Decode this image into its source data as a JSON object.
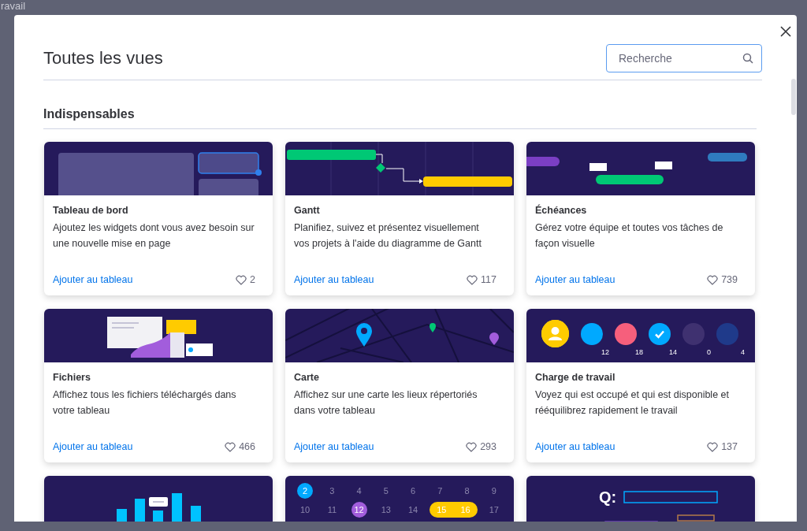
{
  "backdrop": {
    "title": "ravail"
  },
  "modal": {
    "title": "Toutes les vues",
    "search": {
      "placeholder": "Recherche"
    }
  },
  "section": {
    "title": "Indispensables"
  },
  "cards": [
    {
      "kind": "dashboard",
      "title": "Tableau de bord",
      "description": "Ajoutez les widgets dont vous avez besoin sur une nouvelle mise en page",
      "action": "Ajouter au tableau",
      "likes": "2"
    },
    {
      "kind": "gantt",
      "title": "Gantt",
      "description": "Planifiez, suivez et présentez visuellement vos projets à l'aide du diagramme de Gantt",
      "action": "Ajouter au tableau",
      "likes": "117"
    },
    {
      "kind": "timeline",
      "title": "Échéances",
      "description": "Gérez votre équipe et toutes vos tâches de façon visuelle",
      "action": "Ajouter au tableau",
      "likes": "739"
    },
    {
      "kind": "files",
      "title": "Fichiers",
      "description": "Affichez tous les fichiers téléchargés dans votre tableau",
      "action": "Ajouter au tableau",
      "likes": "466"
    },
    {
      "kind": "map",
      "title": "Carte",
      "description": "Affichez sur une carte les lieux répertoriés dans votre tableau",
      "action": "Ajouter au tableau",
      "likes": "293"
    },
    {
      "kind": "workload",
      "title": "Charge de travail",
      "description": "Voyez qui est occupé et qui est disponible et rééquilibrez rapidement le travail",
      "action": "Ajouter au tableau",
      "likes": "137",
      "people": [
        {
          "count": "12",
          "color": "#00a9ff"
        },
        {
          "count": "18",
          "color": "#f65f7c"
        },
        {
          "count": "14",
          "color": "#00a9ff",
          "checked": true
        },
        {
          "count": "0",
          "color": "#3f3170"
        },
        {
          "count": "4",
          "color": "#1f3a8a"
        }
      ]
    },
    {
      "kind": "chart"
    },
    {
      "kind": "calendar",
      "days": [
        {
          "label": "2",
          "kind": "dot",
          "color": "#00a9ff"
        },
        {
          "label": "3",
          "kind": "plain"
        },
        {
          "label": "4",
          "kind": "plain"
        },
        {
          "label": "5",
          "kind": "plain"
        },
        {
          "label": "6",
          "kind": "plain"
        },
        {
          "label": "7",
          "kind": "plain"
        },
        {
          "label": "8",
          "kind": "plain"
        },
        {
          "label": "9",
          "kind": "plain"
        },
        {
          "label": "10",
          "kind": "plain"
        },
        {
          "label": "11",
          "kind": "plain"
        },
        {
          "label": "12",
          "kind": "dot",
          "color": "#a25ddc"
        },
        {
          "label": "13",
          "kind": "plain"
        },
        {
          "label": "14",
          "kind": "plain"
        },
        {
          "label": "15",
          "kind": "range-start",
          "color": "#ffcb00"
        },
        {
          "label": "16",
          "kind": "range-end",
          "color": "#ffcb00"
        },
        {
          "label": "17",
          "kind": "plain"
        }
      ]
    },
    {
      "kind": "form",
      "question": "Q:"
    }
  ]
}
